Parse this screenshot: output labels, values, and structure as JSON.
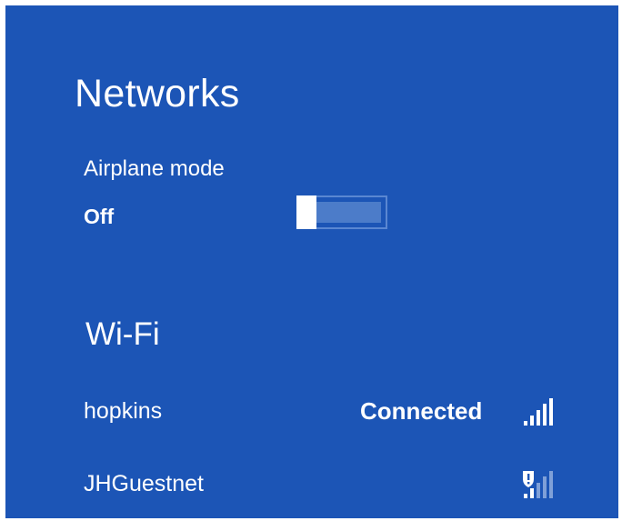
{
  "header": {
    "title": "Networks"
  },
  "airplane_mode": {
    "label": "Airplane mode",
    "state": "Off",
    "enabled": false
  },
  "wifi": {
    "header": "Wi-Fi",
    "networks": [
      {
        "name": "hopkins",
        "status": "Connected",
        "signal_bars": 5,
        "secured": true,
        "icon": "wifi-signal-icon"
      },
      {
        "name": "JHGuestnet",
        "status": "",
        "signal_bars": 5,
        "secured": false,
        "icon": "wifi-signal-warning-icon"
      }
    ]
  },
  "colors": {
    "panel_background": "#1c55b6",
    "text": "#ffffff",
    "toggle_track": "#4c7cc9",
    "toggle_border": "#5a87d2",
    "signal_dim": "#7fa0d8"
  }
}
